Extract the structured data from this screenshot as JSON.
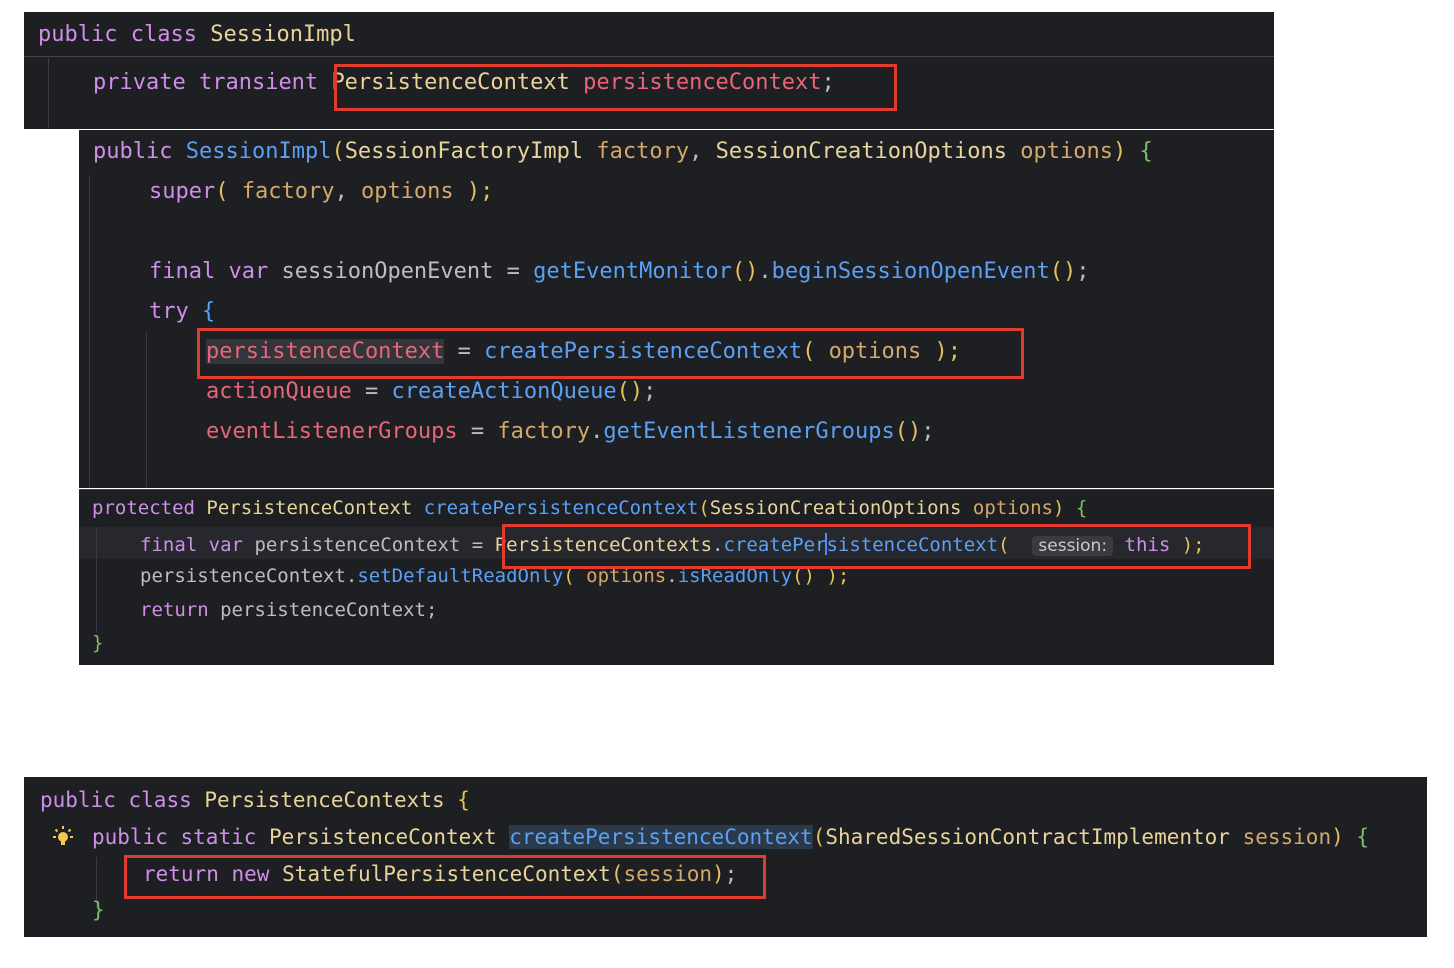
{
  "block1": {
    "line1": {
      "kw1": "public",
      "kw2": "class",
      "name": "SessionImpl"
    },
    "line2": {
      "kw1": "private",
      "kw2": "transient",
      "type": "PersistenceContext",
      "field": "persistenceContext",
      "semi": ";"
    }
  },
  "block2": {
    "ctor": {
      "kw": "public",
      "name": "SessionImpl",
      "p1type": "SessionFactoryImpl",
      "p1": "factory",
      "comma": ",",
      "p2type": "SessionCreationOptions",
      "p2": "options",
      "close": ")",
      "brace": "{"
    },
    "super": {
      "kw": "super",
      "open": "(",
      "a1": "factory",
      "comma": ",",
      "a2": "options",
      "close": ");"
    },
    "final": {
      "kw1": "final",
      "kw2": "var",
      "var": "sessionOpenEvent",
      "eq": "=",
      "m1": "getEventMonitor",
      "p1": "()",
      "dot": ".",
      "m2": "beginSessionOpenEvent",
      "p2": "()",
      "semi": ";"
    },
    "try": {
      "kw": "try",
      "brace": "{"
    },
    "assign1": {
      "field": "persistenceContext",
      "eq": "=",
      "method": "createPersistenceContext",
      "open": "(",
      "arg": "options",
      "close": ");"
    },
    "assign2": {
      "field": "actionQueue",
      "eq": "=",
      "method": "createActionQueue",
      "paren": "()",
      "semi": ";"
    },
    "assign3": {
      "field": "eventListenerGroups",
      "eq": "=",
      "obj": "factory",
      "dot": ".",
      "method": "getEventListenerGroups",
      "paren": "()",
      "semi": ";"
    }
  },
  "block3": {
    "sig": {
      "kw": "protected",
      "type": "PersistenceContext",
      "method": "createPersistenceContext",
      "open": "(",
      "ptype": "SessionCreationOptions",
      "param": "options",
      "close": ")",
      "brace": "{"
    },
    "l1": {
      "kw1": "final",
      "kw2": "var",
      "var": "persistenceContext",
      "eq": "=",
      "cls": "PersistenceContexts",
      "dot": ".",
      "m_a": "createPer",
      "m_b": "sistenceContext",
      "open": "(",
      "hint": "session:",
      "this": "this",
      "close": ");"
    },
    "l2": {
      "var": "persistenceContext",
      "dot": ".",
      "m1": "setDefaultReadOnly",
      "open": "(",
      "obj": "options",
      "dot2": ".",
      "m2": "isReadOnly",
      "p": "()",
      "close": ");"
    },
    "l3": {
      "kw": "return",
      "var": "persistenceContext",
      "semi": ";"
    },
    "end": "}"
  },
  "block4": {
    "l1": {
      "kw1": "public",
      "kw2": "class",
      "name": "PersistenceContexts",
      "brace": "{"
    },
    "l2": {
      "kw1": "public",
      "kw2": "static",
      "type": "PersistenceContext",
      "method": "createPersistenceContext",
      "open": "(",
      "ptype": "SharedSessionContractImplementor",
      "param": "session",
      "close": ")",
      "brace": "{"
    },
    "l3": {
      "kw1": "return",
      "kw2": "new",
      "cls": "StatefulPersistenceContext",
      "open": "(",
      "arg": "session",
      "close": ")",
      "semi": ";"
    },
    "end": "}"
  },
  "icons": {
    "intention": "lightbulb-icon"
  },
  "colors": {
    "background": "#1e1f22",
    "keyword": "#cf8ee8",
    "type": "#e8d49a",
    "field": "#e8657a",
    "method": "#5aa0f5",
    "param": "#d3a86b",
    "highlight_box": "#e23b2d"
  }
}
